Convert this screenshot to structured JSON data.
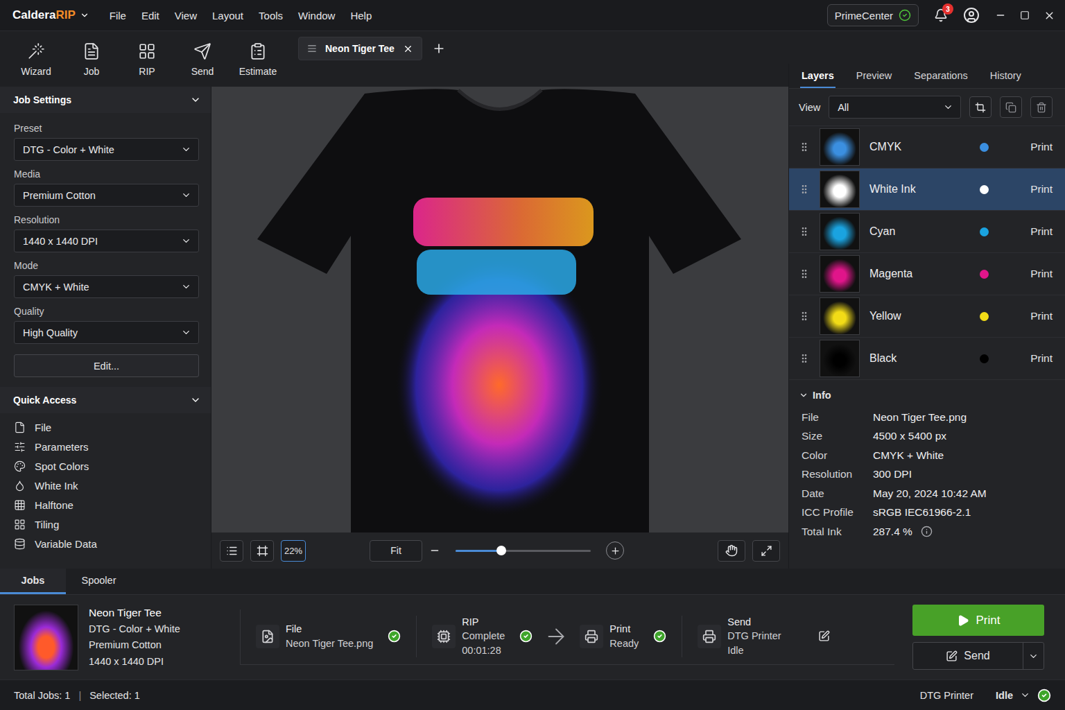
{
  "app": {
    "logo": {
      "name": "Caldera",
      "accent": "RIP"
    },
    "menu": [
      "File",
      "Edit",
      "View",
      "Layout",
      "Tools",
      "Window",
      "Help"
    ],
    "account": "PrimeCenter",
    "account_verified": true,
    "notifications": "3"
  },
  "toolbar": [
    {
      "label": "Wizard"
    },
    {
      "label": "Job"
    },
    {
      "label": "RIP"
    },
    {
      "label": "Send"
    },
    {
      "label": "Estimate"
    }
  ],
  "document_tabs": [
    {
      "label": "Neon Tiger Tee",
      "selected": true
    }
  ],
  "job_settings": {
    "title": "Job Settings",
    "expanded": true,
    "fields": [
      {
        "label": "Preset",
        "value": "DTG - Color + White"
      },
      {
        "label": "Media",
        "value": "Premium Cotton"
      },
      {
        "label": "Resolution",
        "value": "1440 x 1440 DPI"
      },
      {
        "label": "Mode",
        "value": "CMYK + White"
      },
      {
        "label": "Quality",
        "value": "High Quality"
      }
    ],
    "edit_button": "Edit..."
  },
  "quick_access": {
    "title": "Quick Access",
    "expanded": true,
    "items": [
      "File",
      "Parameters",
      "Spot Colors",
      "White Ink",
      "Halftone",
      "Tiling",
      "Variable Data"
    ]
  },
  "canvas": {
    "zoom": "22%",
    "fit": "Fit",
    "zoom_level": 0.34
  },
  "right_panel": {
    "tabs": [
      {
        "label": "Layers",
        "selected": true
      },
      {
        "label": "Preview",
        "selected": false
      },
      {
        "label": "Separations",
        "selected": false
      },
      {
        "label": "History",
        "selected": false
      }
    ],
    "view": {
      "label": "View",
      "value": "All"
    },
    "layers": [
      {
        "name": "CMYK",
        "color": "#3b8fe0",
        "action": "Print",
        "selected": false
      },
      {
        "name": "White Ink",
        "color": "#ffffff",
        "action": "Print",
        "selected": true
      },
      {
        "name": "Cyan",
        "color": "#1aa3e0",
        "action": "Print",
        "selected": false
      },
      {
        "name": "Magenta",
        "color": "#e0158a",
        "action": "Print",
        "selected": false
      },
      {
        "name": "Yellow",
        "color": "#f2dc17",
        "action": "Print",
        "selected": false
      },
      {
        "name": "Black",
        "color": "#000000",
        "action": "Print",
        "selected": false
      }
    ],
    "info": {
      "title": "Info",
      "expanded": true,
      "rows": [
        {
          "key": "File",
          "value": "Neon Tiger Tee.png",
          "kind": "plain"
        },
        {
          "key": "Size",
          "value": "4500 x 5400 px",
          "kind": "plain"
        },
        {
          "key": "Color",
          "value": "CMYK + White",
          "kind": "plain"
        },
        {
          "key": "Resolution",
          "value": "300 DPI",
          "kind": "plain"
        },
        {
          "key": "Date",
          "value": "May 20, 2024 10:42 AM",
          "kind": "plain"
        },
        {
          "key": "ICC Profile",
          "value": "sRGB IEC61966-2.1",
          "kind": "plain"
        },
        {
          "key": "Total Ink",
          "value": "287.4 %",
          "kind": "hint"
        }
      ]
    }
  },
  "jobs_panel": {
    "tabs": [
      {
        "label": "Jobs",
        "selected": true
      },
      {
        "label": "Spooler",
        "selected": false
      }
    ],
    "job": {
      "name": "Neon Tiger Tee",
      "details": [
        "DTG - Color + White",
        "Premium Cotton",
        "1440 x 1440 DPI"
      ]
    },
    "pipeline": [
      {
        "title": "File",
        "lines": [
          "Neon Tiger Tee.png"
        ],
        "done": true,
        "connector_kind": "line"
      },
      {
        "title": "RIP",
        "lines": [
          "Complete",
          "00:01:28"
        ],
        "done": true,
        "connector_kind": "arrow"
      },
      {
        "title": "Print",
        "lines": [
          "Ready"
        ],
        "done": true,
        "connector_kind": "line"
      },
      {
        "title": "Send",
        "lines": [
          "DTG Printer",
          "Idle"
        ],
        "done": false,
        "connector_kind": "none"
      }
    ],
    "actions": {
      "print": "Print",
      "send": "Send"
    }
  },
  "status_bar": {
    "total": "Total Jobs: 1",
    "separator": "|",
    "selected": "Selected: 1",
    "printer": "DTG Printer",
    "printer_state": "Idle",
    "online": true
  }
}
